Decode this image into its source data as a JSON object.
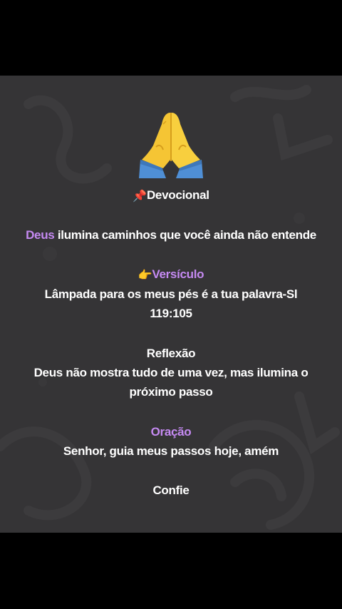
{
  "post": {
    "title_icon": "pushpin-icon",
    "title": "Devocional",
    "headline_highlight": "Deus",
    "headline_rest": " ilumina caminhos que você ainda não entende",
    "verse_icon": "pointing-hand-icon",
    "verse_heading": "Versículo",
    "verse_line1": "Lâmpada para os meus pés é a tua palavra-Sl",
    "verse_line2": "119:105",
    "reflection_heading": "Reflexão",
    "reflection_line1": "Deus não mostra tudo de uma vez, mas ilumina o",
    "reflection_line2": "próximo passo",
    "prayer_heading": "Oração",
    "prayer_text": "Senhor, guia meus passos hoje, amém",
    "closing": "Confie"
  },
  "colors": {
    "panel_background": "#353436",
    "accent_purple": "#c58af2",
    "text": "#ffffff",
    "letterbox": "#000000"
  }
}
